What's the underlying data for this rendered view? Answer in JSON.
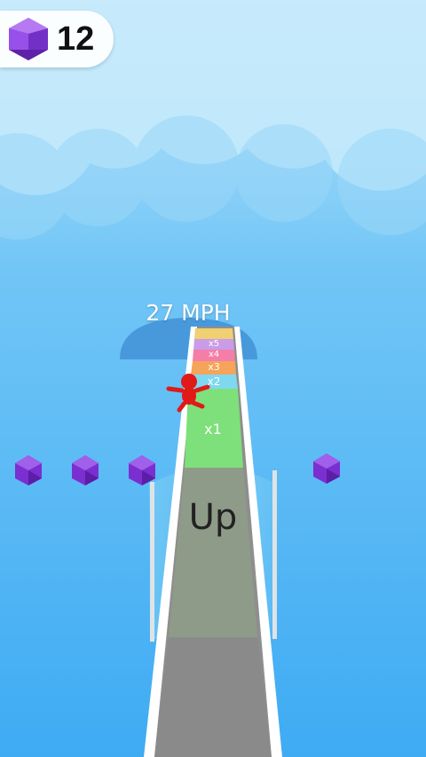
{
  "hud": {
    "gem_count": "12",
    "gem_icon": "purple-gem-icon"
  },
  "speed": {
    "label": "27 MPH"
  },
  "track": {
    "ramp_label": "Up",
    "multipliers": [
      "x1",
      "x2",
      "x3",
      "x4",
      "x5"
    ]
  },
  "colors": {
    "sky_top": "#bfe6fb",
    "sky_bottom": "#3faef4",
    "gem": "#7b2fd1",
    "runner": "#e01919",
    "x1": "#7ee07a",
    "x2": "#7fd8f0",
    "x3": "#f5a45a",
    "x4": "#f47ea8",
    "x5": "#c99ce8"
  }
}
